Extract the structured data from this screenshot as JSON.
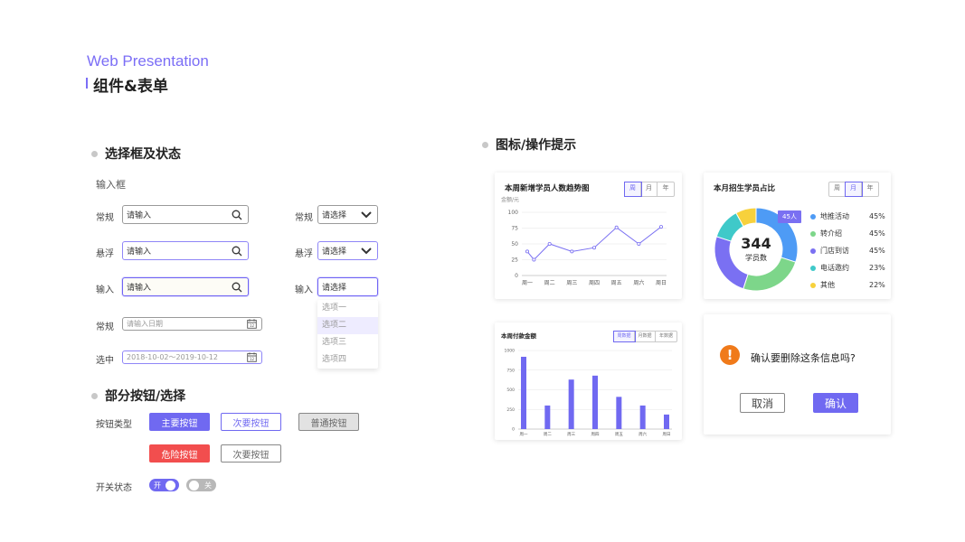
{
  "header": {
    "brand_en": "Web Presentation",
    "brand_cn": "组件&表单"
  },
  "colors": {
    "accent": "#7069f1",
    "danger": "#f24e4e",
    "warning": "#f07a1a"
  },
  "select_section": {
    "title": "选择框及状态",
    "subtitle": "输入框",
    "inputs": [
      {
        "label": "常规",
        "placeholder": "请输入",
        "state": "normal",
        "icon": "search-icon"
      },
      {
        "label": "悬浮",
        "placeholder": "请输入",
        "state": "hover",
        "icon": "search-icon"
      },
      {
        "label": "输入",
        "placeholder": "请输入",
        "state": "focus",
        "icon": "search-icon"
      }
    ],
    "selects": [
      {
        "label": "常规",
        "value": "请选择",
        "icon": "chevron-down-icon"
      },
      {
        "label": "悬浮",
        "value": "请选择",
        "icon": "chevron-down-icon"
      },
      {
        "label": "输入",
        "value": "请选择"
      }
    ],
    "dropdown_options": [
      "选项一",
      "选项二",
      "选项三",
      "选项四"
    ],
    "dropdown_active": "选项二",
    "dates": [
      {
        "label": "常规",
        "value": "请输入日期",
        "icon": "calendar-icon"
      },
      {
        "label": "选中",
        "value": "2018-10-02～2019-10-12",
        "icon": "calendar-icon"
      }
    ]
  },
  "button_section": {
    "title": "部分按钮/选择",
    "type_label": "按钮类型",
    "primary": "主要按钮",
    "secondary": "次要按钮",
    "normal": "普通按钮",
    "danger": "危险按钮",
    "plain": "次要按钮",
    "switch_label": "开关状态",
    "switch_on": "开",
    "switch_off": "关"
  },
  "icon_section": {
    "title": "图标/操作提示"
  },
  "line_card": {
    "title": "本周新增学员人数趋势图",
    "unit": "金额/元",
    "tabs": [
      "周",
      "月",
      "年"
    ],
    "selected_tab": "周"
  },
  "donut_card": {
    "title": "本月招生学员占比",
    "tabs": [
      "周",
      "月",
      "年"
    ],
    "selected_tab": "月",
    "center_value": "344",
    "center_label": "学员数",
    "tooltip": "45人",
    "legend": [
      {
        "name": "地推活动",
        "value": "45%",
        "color": "#4e9bf5"
      },
      {
        "name": "转介绍",
        "value": "45%",
        "color": "#7dd68a"
      },
      {
        "name": "门店到访",
        "value": "45%",
        "color": "#7a70f2"
      },
      {
        "name": "电话邀约",
        "value": "23%",
        "color": "#3fc9c9"
      },
      {
        "name": "其他",
        "value": "22%",
        "color": "#f7d13c"
      }
    ]
  },
  "bar_card": {
    "title": "本周付款金额",
    "tabs": [
      "周数据",
      "月数据",
      "年数据"
    ],
    "selected_tab": "周数据"
  },
  "modal": {
    "message": "确认要删除这条信息吗?",
    "cancel": "取消",
    "confirm": "确认",
    "icon": "warning-icon"
  },
  "chart_data": [
    {
      "type": "line",
      "categories": [
        "周一",
        "周二",
        "周三",
        "周四",
        "周五",
        "周六",
        "周日"
      ],
      "x": [
        0.0,
        0.3,
        1,
        2,
        3,
        4,
        5,
        6
      ],
      "values": [
        38,
        25,
        50,
        38,
        44,
        76,
        50,
        77
      ],
      "ylabel": "金额/元",
      "ylim": [
        0,
        100
      ],
      "yticks": [
        0,
        25,
        50,
        75,
        100
      ],
      "color": "#7a70f2",
      "grid": true
    },
    {
      "type": "pie",
      "labels": [
        "地推活动",
        "转介绍",
        "门店到访",
        "电话邀约",
        "其他"
      ],
      "values": [
        30,
        25,
        25,
        12,
        8
      ],
      "colors": [
        "#4e9bf5",
        "#7dd68a",
        "#7a70f2",
        "#3fc9c9",
        "#f7d13c"
      ]
    },
    {
      "type": "bar",
      "categories": [
        "周一",
        "周二",
        "周三",
        "周四",
        "周五",
        "周六",
        "周日"
      ],
      "values": [
        920,
        300,
        630,
        680,
        410,
        300,
        185
      ],
      "ylim": [
        0,
        1000
      ],
      "yticks": [
        0,
        250,
        500,
        750,
        1000
      ],
      "color": "#7069f1",
      "grid": true
    }
  ]
}
